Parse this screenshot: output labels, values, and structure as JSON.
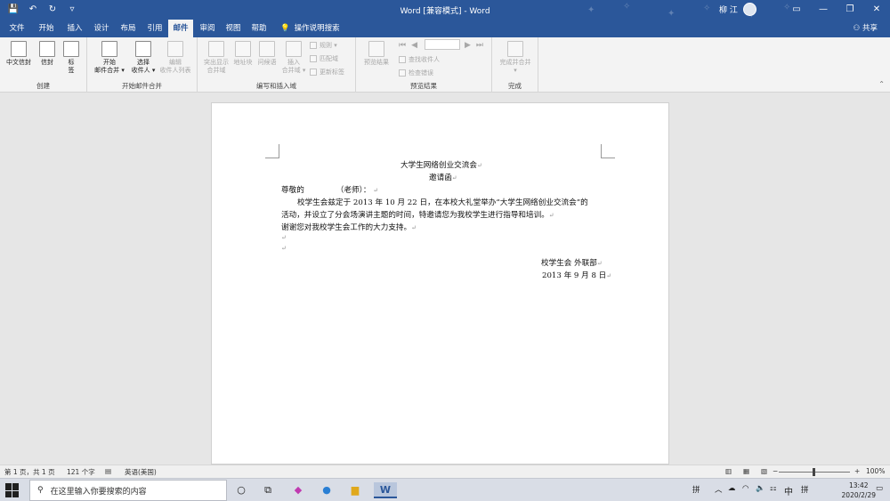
{
  "titlebar": {
    "doc_title": "Word [兼容模式]  -  Word",
    "user_name": "柳 江",
    "minimize": "—",
    "restore": "❐",
    "close": "✕",
    "ribbon_options": "▭"
  },
  "tabs": [
    {
      "label": "文件"
    },
    {
      "label": "开始"
    },
    {
      "label": "插入"
    },
    {
      "label": "设计"
    },
    {
      "label": "布局"
    },
    {
      "label": "引用"
    },
    {
      "label": "邮件"
    },
    {
      "label": "审阅"
    },
    {
      "label": "视图"
    },
    {
      "label": "帮助"
    }
  ],
  "help_search": "操作说明搜索",
  "share": "共享",
  "ribbon": {
    "groups": {
      "create": "创建",
      "start_merge": "开始邮件合并",
      "write_insert": "编写和插入域",
      "preview": "预览结果",
      "finish": "完成"
    },
    "buttons": {
      "cn_envelope": "中文信封",
      "envelope": "信封",
      "label_1": "标",
      "label_2": "签",
      "start_merge_1": "开始",
      "start_merge_2": "邮件合并 ▾",
      "select_1": "选择",
      "select_2": "收件人 ▾",
      "edit_list_1": "编辑",
      "edit_list_2": "收件人列表",
      "highlight_1": "突出显示",
      "highlight_2": "合并域",
      "address_block": "地址块",
      "greeting": "问候语",
      "insert_field_1": "插入",
      "insert_field_2": "合并域 ▾",
      "rules": "规则 ▾",
      "match": "匹配域",
      "update_labels": "更新标签",
      "preview": "预览结果",
      "find_recipient": "查找收件人",
      "check_errors": "检查错误",
      "finish_1": "完成并合并",
      "finish_2": "▾"
    }
  },
  "document": {
    "title": "大学生网络创业交流会",
    "subtitle": "邀请函",
    "salutation_1": "尊敬的",
    "salutation_2": "（老师）：",
    "body_1": "校学生会兹定于 2013 年 10 月 22 日，在本校大礼堂举办“大学生网络创业交流会”的",
    "body_2": "活动，并设立了分会场演讲主题的时间，特邀请您为我校学生进行指导和培训。",
    "body_3": "谢谢您对我校学生会工作的大力支持。",
    "signature": "校学生会  外联部",
    "date": "2013 年 9 月 8 日",
    "para_mark": "↵"
  },
  "statusbar": {
    "page": "第 1 页，共 1 页",
    "words": "121 个字",
    "language": "英语(美国)",
    "zoom": "100%",
    "zoom_minus": "−",
    "zoom_plus": "+"
  },
  "taskbar": {
    "search_placeholder": "在这里输入你要搜索的内容",
    "ime_1": "拼",
    "ime_2": "中",
    "ime_3": "拼",
    "time": "13:42",
    "date": "2020/2/29"
  }
}
